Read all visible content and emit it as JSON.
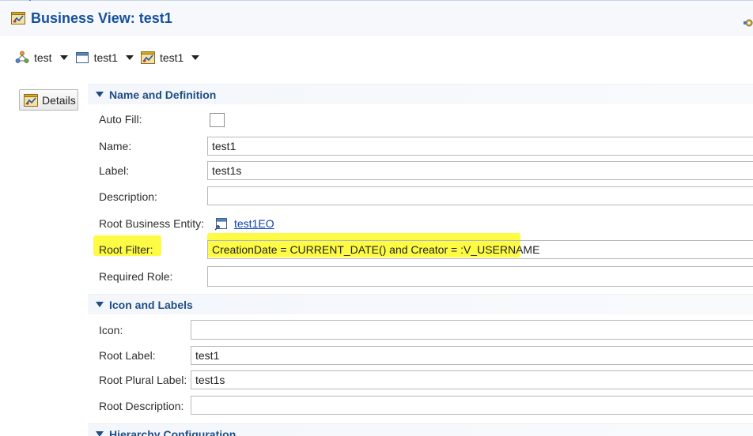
{
  "window": {
    "title": "Business View: test1"
  },
  "breadcrumbs": [
    {
      "label": "test",
      "icon": "application-module-icon"
    },
    {
      "label": "test1",
      "icon": "view-window-icon"
    },
    {
      "label": "test1",
      "icon": "business-view-icon"
    }
  ],
  "side_nav": {
    "details_label": "Details"
  },
  "sections": {
    "name_definition": {
      "title": "Name and Definition"
    },
    "icon_labels": {
      "title": "Icon and Labels"
    },
    "hierarchy": {
      "title": "Hierarchy Configuration"
    }
  },
  "form": {
    "auto_fill": {
      "label": "Auto Fill:",
      "checked": false
    },
    "name": {
      "label": "Name:",
      "value": "test1"
    },
    "label": {
      "label": "Label:",
      "value": "test1s"
    },
    "description": {
      "label": "Description:",
      "value": ""
    },
    "root_business_entity": {
      "label": "Root Business Entity:",
      "value": "test1EO"
    },
    "root_filter": {
      "label": "Root Filter:",
      "value": "CreationDate = CURRENT_DATE() and Creator = :V_USERNAME"
    },
    "required_role": {
      "label": "Required Role:",
      "value": ""
    },
    "icon": {
      "label": "Icon:",
      "value": ""
    },
    "root_label": {
      "label": "Root Label:",
      "value": "test1"
    },
    "root_plural_label": {
      "label": "Root Plural Label:",
      "value": "test1s"
    },
    "root_description": {
      "label": "Root Description:",
      "value": ""
    }
  },
  "colors": {
    "title": "#15519b",
    "section_text": "#1f4e86",
    "highlight": "#fefb3a",
    "link": "#0a3fb0"
  }
}
